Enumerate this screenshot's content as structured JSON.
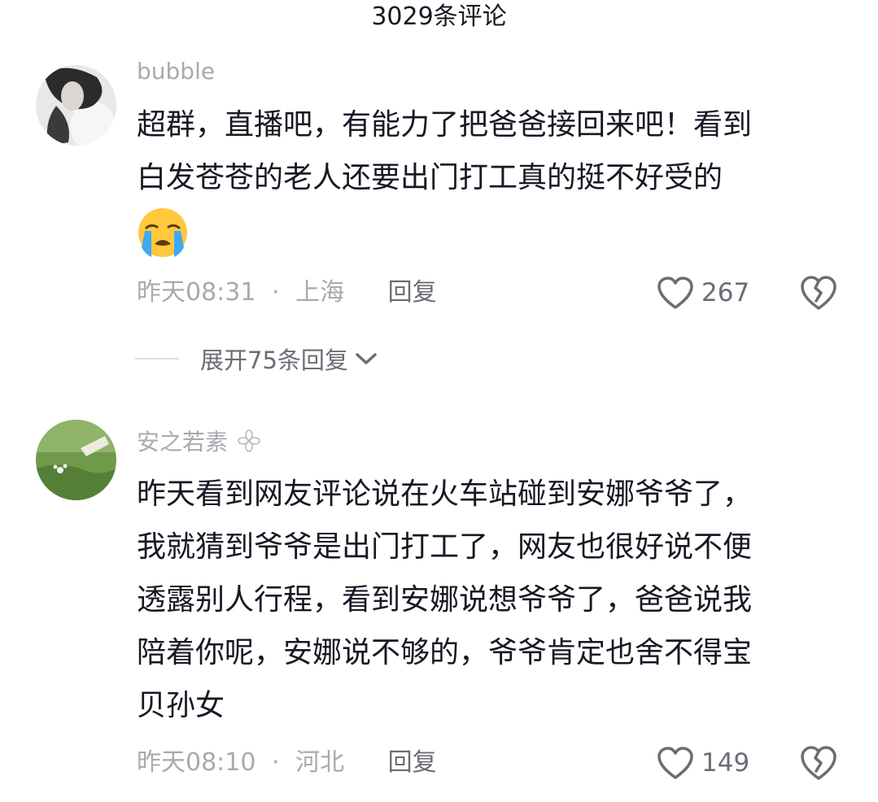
{
  "header": {
    "title": "3029条评论"
  },
  "comments": [
    {
      "username": "bubble",
      "lines": [
        "超群，直播吧，有能力了把爸爸接回来吧！看到",
        "白发苍苍的老人还要出门打工真的挺不好受的"
      ],
      "emoji": "loudly-crying-face",
      "time": "昨天08:31",
      "separator": "·",
      "location": "上海",
      "reply_label": "回复",
      "likes": "267",
      "expand_label": "展开75条回复"
    },
    {
      "username": "安之若素",
      "lines": [
        "昨天看到网友评论说在火车站碰到安娜爷爷了，",
        "我就猜到爷爷是出门打工了，网友也很好说不便",
        "透露别人行程，看到安娜说想爷爷了，爸爸说我",
        "陪着你呢，安娜说不够的，爷爷肯定也舍不得宝",
        "贝孙女"
      ],
      "time": "昨天08:10",
      "separator": "·",
      "location": "河北",
      "reply_label": "回复",
      "likes": "149"
    }
  ],
  "colors": {
    "primary_text": "#161823",
    "secondary_text": "#a9aab0",
    "action_text": "#6b6d75"
  }
}
